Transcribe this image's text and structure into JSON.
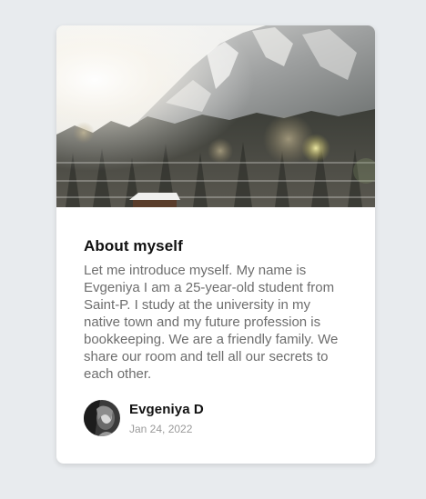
{
  "card": {
    "title": "About myself",
    "body": "Let me introduce myself. My name is Evgeniya I am a 25-year-old student from Saint-P. I study at the university in my native town and my future profession is bookkeeping. We are a friendly family. We share our room and tell all our secrets to each other.",
    "cover_image": "snowy-mountain-forest-photo"
  },
  "author": {
    "name": "Evgeniya D",
    "date": "Jan 24, 2022",
    "avatar": "author-avatar-photo"
  },
  "colors": {
    "background": "#e8ebee",
    "card": "#ffffff",
    "title": "#111111",
    "body_text": "#6d6d6d",
    "date_text": "#9a9a9a"
  }
}
